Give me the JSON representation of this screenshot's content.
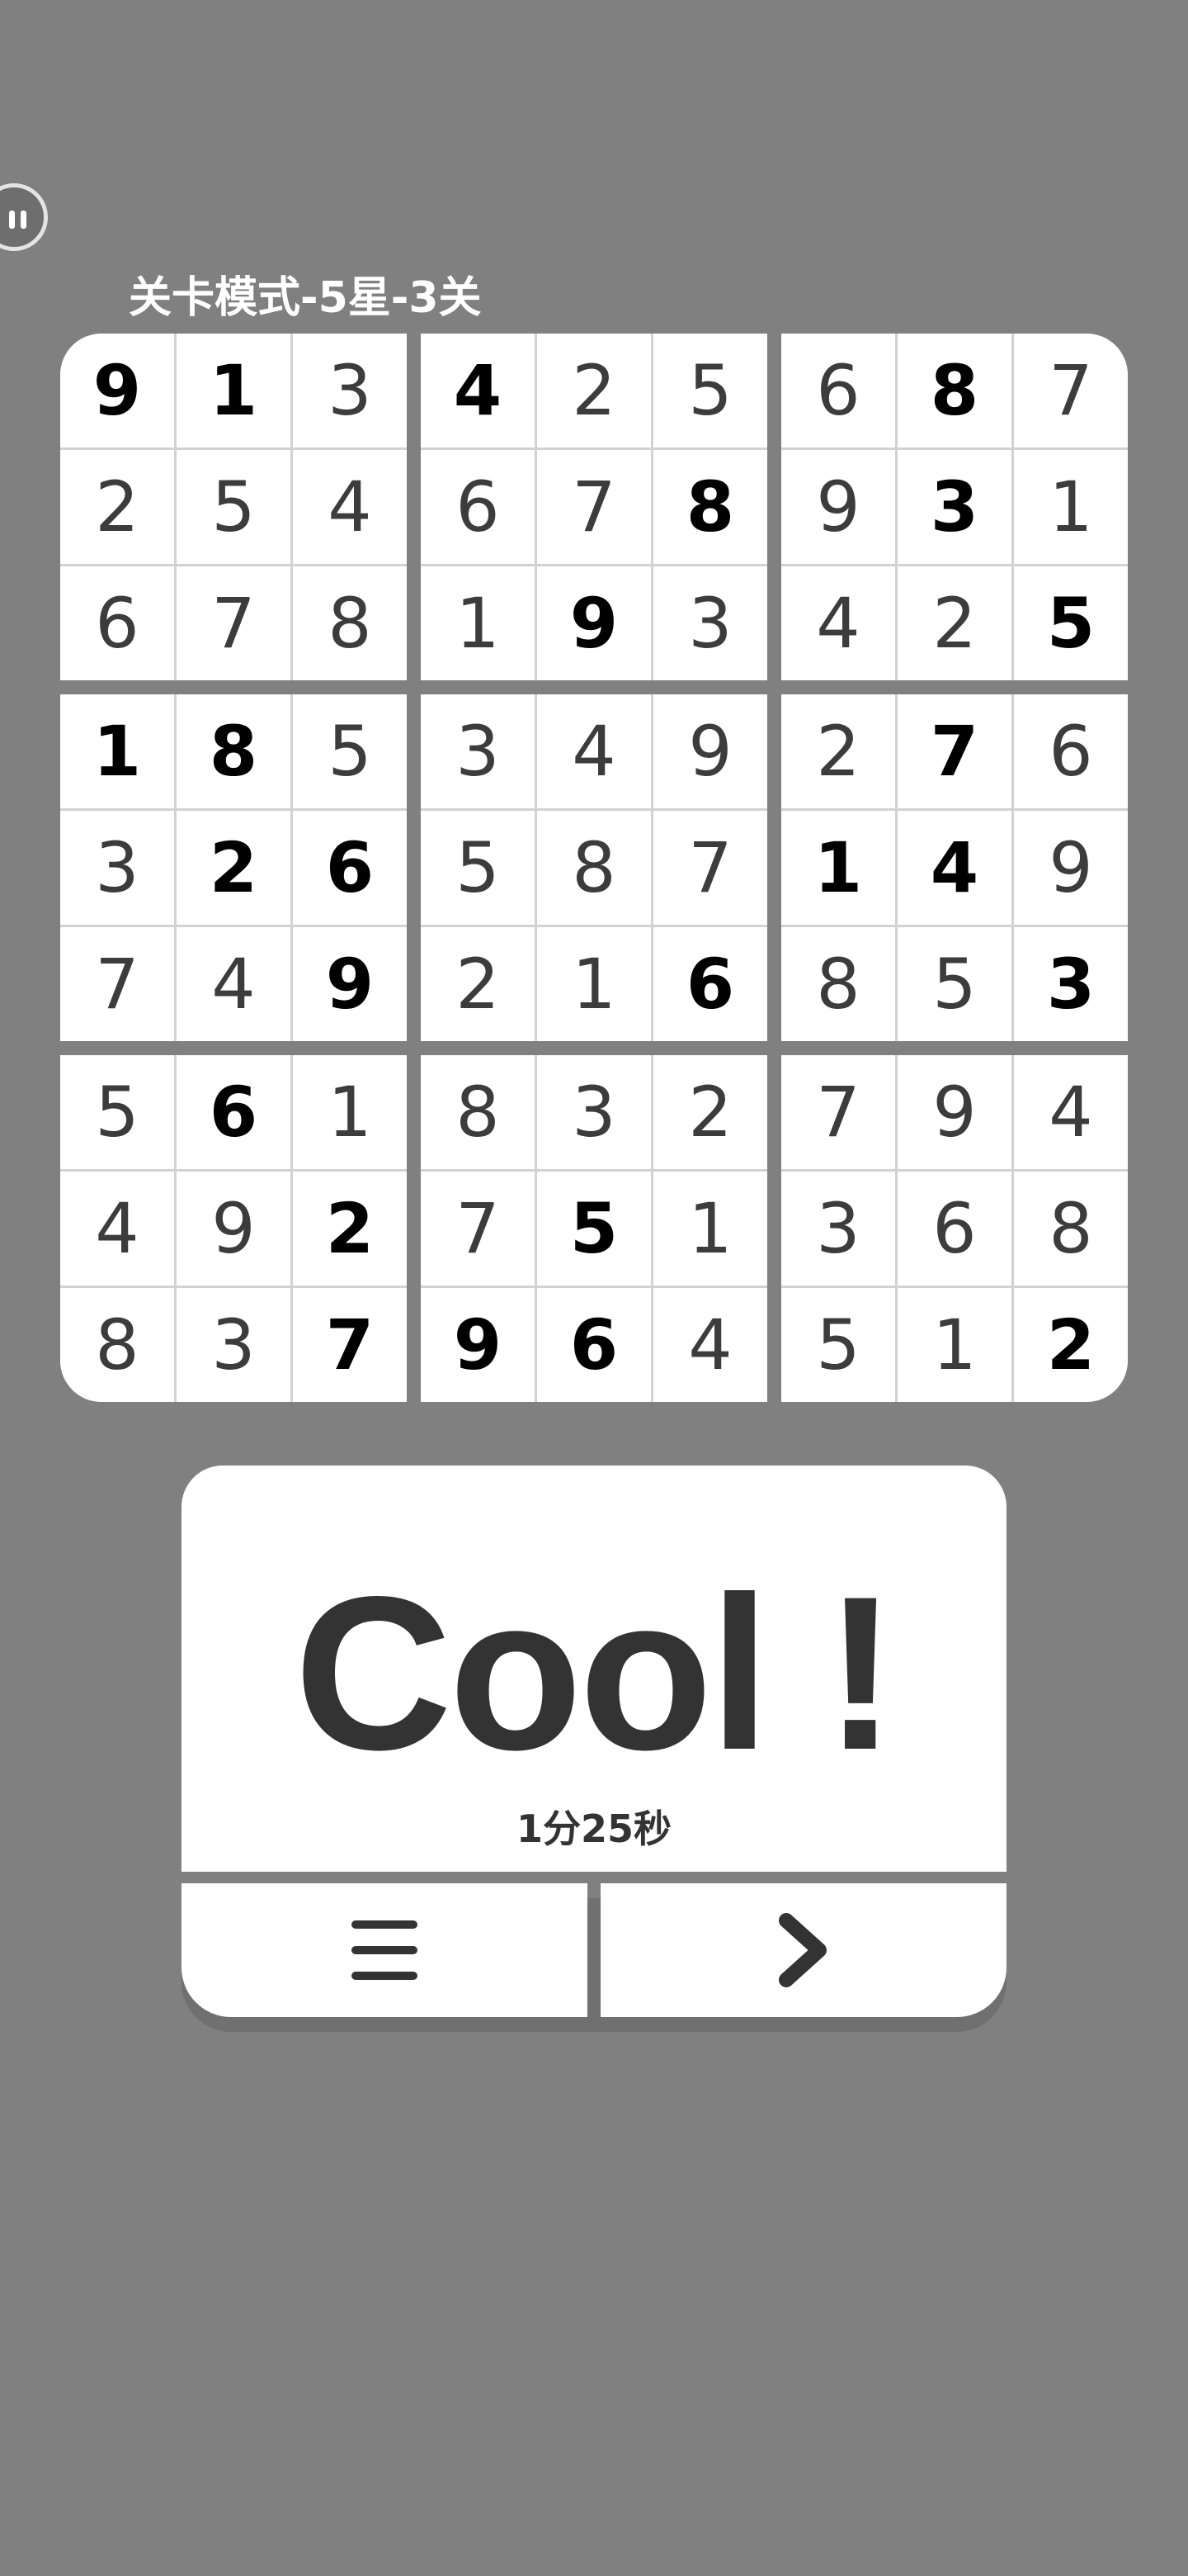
{
  "header": {
    "level_title": "关卡模式-5星-3关",
    "corner_button_icon": "pause-icon"
  },
  "sudoku": {
    "rows": [
      [
        9,
        1,
        3,
        4,
        2,
        5,
        6,
        8,
        7
      ],
      [
        2,
        5,
        4,
        6,
        7,
        8,
        9,
        3,
        1
      ],
      [
        6,
        7,
        8,
        1,
        9,
        3,
        4,
        2,
        5
      ],
      [
        1,
        8,
        5,
        3,
        4,
        9,
        2,
        7,
        6
      ],
      [
        3,
        2,
        6,
        5,
        8,
        7,
        1,
        4,
        9
      ],
      [
        7,
        4,
        9,
        2,
        1,
        6,
        8,
        5,
        3
      ],
      [
        5,
        6,
        1,
        8,
        3,
        2,
        7,
        9,
        4
      ],
      [
        4,
        9,
        2,
        7,
        5,
        1,
        3,
        6,
        8
      ],
      [
        8,
        3,
        7,
        9,
        6,
        4,
        5,
        1,
        2
      ]
    ],
    "given": [
      [
        1,
        1,
        0,
        1,
        0,
        0,
        0,
        1,
        0
      ],
      [
        0,
        0,
        0,
        0,
        0,
        1,
        0,
        1,
        0
      ],
      [
        0,
        0,
        0,
        0,
        1,
        0,
        0,
        0,
        1
      ],
      [
        1,
        1,
        0,
        0,
        0,
        0,
        0,
        1,
        0
      ],
      [
        0,
        1,
        1,
        0,
        0,
        0,
        1,
        1,
        0
      ],
      [
        0,
        0,
        1,
        0,
        0,
        1,
        0,
        0,
        1
      ],
      [
        0,
        1,
        0,
        0,
        0,
        0,
        0,
        0,
        0
      ],
      [
        0,
        0,
        1,
        0,
        1,
        0,
        0,
        0,
        0
      ],
      [
        0,
        0,
        1,
        1,
        1,
        0,
        0,
        0,
        1
      ]
    ]
  },
  "result": {
    "headline": "Cool !",
    "time": "1分25秒"
  },
  "buttons": {
    "menu_icon": "menu-icon",
    "next_icon": "chevron-right-icon"
  },
  "colors": {
    "background": "#808080",
    "card": "#ffffff",
    "text_dark": "#333333",
    "given_digit": "#000000",
    "filled_digit": "#3c3c3c"
  }
}
